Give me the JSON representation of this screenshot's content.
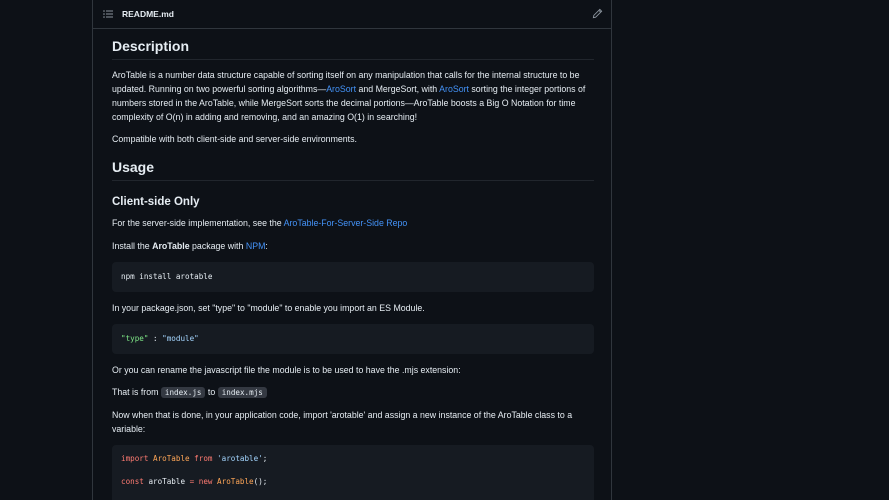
{
  "file_header": {
    "filename": "README.md",
    "list_icon": "list-icon",
    "edit_icon": "pencil-icon"
  },
  "description": {
    "heading": "Description",
    "p1": {
      "t1": "AroTable is a number data structure capable of sorting itself on any manipulation that calls for the internal structure to be updated. Running on two powerful sorting algorithms—",
      "link1": "AroSort",
      "t2": " and MergeSort, with ",
      "link2": "AroSort",
      "t3": " sorting the integer portions of numbers stored in the AroTable, while MergeSort sorts the decimal portions—AroTable boosts a Big O Notation for time complexity of O(n) in adding and removing, and an amazing O(1) in searching!"
    },
    "p2": "Compatible with both client-side and server-side environments."
  },
  "usage": {
    "heading": "Usage",
    "client_heading": "Client-side Only",
    "p_server": {
      "t1": "For the server-side implementation, see the ",
      "link": "AroTable-For-Server-Side Repo"
    },
    "p_install": {
      "t1": "Install the ",
      "bold": "AroTable",
      "t2": " package with ",
      "link": "NPM",
      "t3": ":"
    },
    "code_install": "npm install arotable",
    "p_package": "In your package.json, set \"type\" to \"module\" to enable you import an ES Module.",
    "code_type": {
      "key": "\"type\"",
      "sep": " : ",
      "value": "\"module\""
    },
    "p_rename": "Or you can rename the javascript file the module is to be used to have the .mjs extension:",
    "p_from": {
      "t1": "That is from ",
      "code1": "index.js",
      "t2": " to ",
      "code2": "index.mjs"
    },
    "p_now": "Now when that is done, in your application code, import 'arotable' and assign a new instance of the AroTable class to a variable:",
    "code_import": {
      "kw_import": "import",
      "cls1": "AroTable",
      "kw_from": "from",
      "module": "'arotable'",
      "semi1": ";",
      "kw_const": "const",
      "var": "aroTable",
      "eq": "=",
      "kw_new": "new",
      "cls2": "AroTable",
      "tail": "();"
    }
  }
}
